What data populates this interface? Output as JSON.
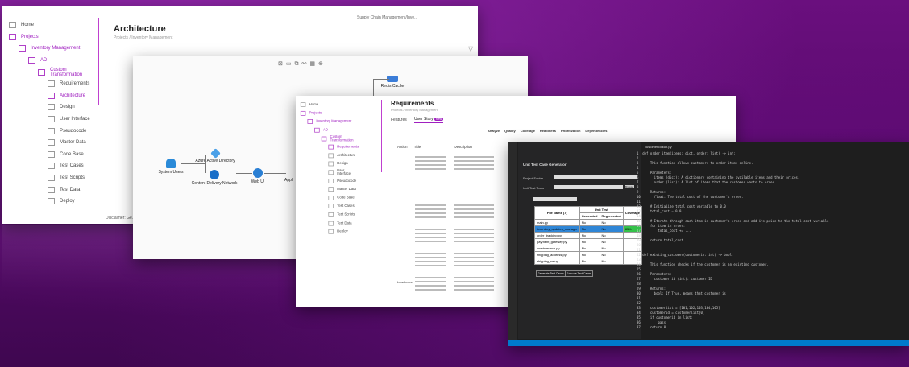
{
  "window1": {
    "path": "Supply Chain Management/Inve...",
    "title": "Architecture",
    "breadcrumb": "Projects / Inventory Management",
    "sidebar": [
      {
        "label": "Home",
        "level": 0,
        "active": false
      },
      {
        "label": "Projects",
        "level": 0,
        "active": true
      },
      {
        "label": "Inventory Management",
        "level": 1,
        "active": true
      },
      {
        "label": "AD",
        "level": 2,
        "active": true
      },
      {
        "label": "Custom Transformation",
        "level": 3,
        "active": true
      },
      {
        "label": "Requirements",
        "level": 4,
        "active": false
      },
      {
        "label": "Architecture",
        "level": 4,
        "active": true
      },
      {
        "label": "Design",
        "level": 4,
        "active": false
      },
      {
        "label": "User Interface",
        "level": 4,
        "active": false
      },
      {
        "label": "Pseudocode",
        "level": 4,
        "active": false
      },
      {
        "label": "Master Data",
        "level": 4,
        "active": false
      },
      {
        "label": "Code Base",
        "level": 4,
        "active": false
      },
      {
        "label": "Test Cases",
        "level": 4,
        "active": false
      },
      {
        "label": "Test Scripts",
        "level": 4,
        "active": false
      },
      {
        "label": "Test Data",
        "level": 4,
        "active": false
      },
      {
        "label": "Deploy",
        "level": 4,
        "active": false
      }
    ],
    "disclaimer": "Disclaimer: Ge..."
  },
  "window2": {
    "nodes": {
      "system_users": "System Users",
      "azure_ad": "Azure Active Directory",
      "cdn": "Content Delivery Network",
      "web_ui": "Web UI",
      "appl": "Appl",
      "redis": "Redis Cache"
    }
  },
  "window3": {
    "title": "Requirements",
    "breadcrumb": "Projects / Inventory Management",
    "tabs": [
      "Features",
      "User Story"
    ],
    "badge": "New",
    "toolbar": [
      "Analyze",
      "Quality",
      "Coverage",
      "Readiness",
      "Prioritization",
      "Dependencies"
    ],
    "columns": [
      "Action",
      "Title",
      "Description"
    ],
    "sidebar": [
      {
        "label": "Home",
        "level": 0,
        "active": false
      },
      {
        "label": "Projects",
        "level": 0,
        "active": true
      },
      {
        "label": "Inventory Management",
        "level": 1,
        "active": true
      },
      {
        "label": "AD",
        "level": 2,
        "active": true
      },
      {
        "label": "Custom Transformation",
        "level": 3,
        "active": true
      },
      {
        "label": "Requirements",
        "level": 4,
        "active": true
      },
      {
        "label": "Architecture",
        "level": 4,
        "active": false
      },
      {
        "label": "Design",
        "level": 4,
        "active": false
      },
      {
        "label": "User Interface",
        "level": 4,
        "active": false
      },
      {
        "label": "Pseudocode",
        "level": 4,
        "active": false
      },
      {
        "label": "Master Data",
        "level": 4,
        "active": false
      },
      {
        "label": "Code Base",
        "level": 4,
        "active": false
      },
      {
        "label": "Test Cases",
        "level": 4,
        "active": false
      },
      {
        "label": "Test Scripts",
        "level": 4,
        "active": false
      },
      {
        "label": "Test Data",
        "level": 4,
        "active": false
      },
      {
        "label": "Deploy",
        "level": 4,
        "active": false
      }
    ],
    "load_more": "Load more"
  },
  "window4": {
    "panel_title": "Unit Test Case Generator",
    "project_folder_label": "Project Folder",
    "unit_test_tools_label": "Unit Test Tools",
    "browse": "Browse",
    "table_headers": [
      "File Name (7)",
      "Generated",
      "Regenerated",
      "Coverage"
    ],
    "unit_test_header": "Unit Test",
    "rows": [
      {
        "name": "main.py",
        "gen": "No",
        "regen": "No",
        "cov": ""
      },
      {
        "name": "inventory_updates_manager",
        "gen": "No",
        "regen": "No",
        "cov": "85%"
      },
      {
        "name": "order_tracking.py",
        "gen": "No",
        "regen": "No",
        "cov": ""
      },
      {
        "name": "payment_gateway.py",
        "gen": "No",
        "regen": "No",
        "cov": ""
      },
      {
        "name": "userinterface.py",
        "gen": "No",
        "regen": "No",
        "cov": ""
      },
      {
        "name": "shipping_address.py",
        "gen": "No",
        "regen": "No",
        "cov": ""
      },
      {
        "name": "shipping_setup",
        "gen": "No",
        "regen": "No",
        "cov": ""
      }
    ],
    "buttons": [
      "Generate Test Cases",
      "Execute Test Cases"
    ],
    "editor_tab": "customerlookup.py",
    "code": [
      "1  def order_item(items: dict, order: list) -> int:",
      "2",
      "3      This function allows customers to order items online.",
      "4",
      "5      Parameters:",
      "6        items (dict): A dictionary containing the available items and their prices.",
      "7        order (list): A list of items that the customer wants to order.",
      "8",
      "9      Returns:",
      "10       float: The total cost of the customer's order.",
      "11",
      "12     # Initialize total cost variable to 0.0",
      "13     total_cost = 0.0",
      "14",
      "15     # Iterate through each item in customer's order and add its price to the total cost variable",
      "16     for item in order:",
      "17         total_cost += ...",
      "18",
      "19     return total_cost",
      "20",
      "21",
      "22 def existing_customer(customerid: int) -> bool:",
      "23",
      "24     This function checks if the customer is an existing customer.",
      "25",
      "26     Parameters:",
      "27       customer id (int): customer ID",
      "28",
      "29     Returns:",
      "30       bool: If True, means that customer is",
      "31",
      "32",
      "33     customerlist = [101,102,103,104,105]",
      "34     customerid = customerlist[0]",
      "35     if customerid in list:",
      "36         pass",
      "37     return 0"
    ]
  }
}
